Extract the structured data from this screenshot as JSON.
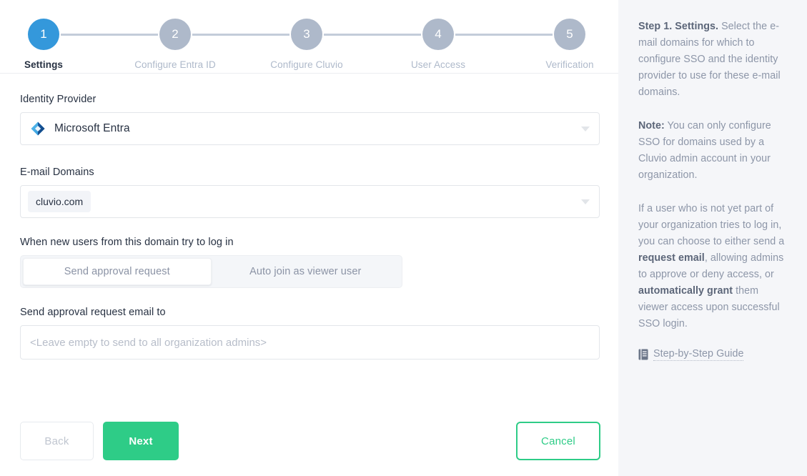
{
  "stepper": {
    "steps": [
      {
        "number": "1",
        "label": "Settings",
        "active": true
      },
      {
        "number": "2",
        "label": "Configure Entra ID",
        "active": false
      },
      {
        "number": "3",
        "label": "Configure Cluvio",
        "active": false
      },
      {
        "number": "4",
        "label": "User Access",
        "active": false
      },
      {
        "number": "5",
        "label": "Verification",
        "active": false
      }
    ],
    "active_color": "#3498db",
    "inactive_color": "#aeb9ca"
  },
  "form": {
    "identity_provider": {
      "label": "Identity Provider",
      "value": "Microsoft Entra",
      "icon": "microsoft-entra-logo"
    },
    "email_domains": {
      "label": "E-mail Domains",
      "tags": [
        "cluvio.com"
      ]
    },
    "new_user_policy": {
      "label": "When new users from this domain try to log in",
      "options": [
        {
          "label": "Send approval request",
          "selected": true
        },
        {
          "label": "Auto join as viewer user",
          "selected": false
        }
      ]
    },
    "approval_email": {
      "label": "Send approval request email to",
      "value": "",
      "placeholder": "<Leave empty to send to all organization admins>"
    }
  },
  "footer": {
    "back_label": "Back",
    "next_label": "Next",
    "cancel_label": "Cancel",
    "primary_color": "#2ecc87"
  },
  "help": {
    "paragraph1_bold": "Step 1. Settings.",
    "paragraph1_rest": " Select the e-mail domains for which to configure SSO and the identity provider to use for these e-mail domains.",
    "paragraph2_bold": "Note:",
    "paragraph2_rest": " You can only configure SSO for domains used by a Cluvio admin account in your organization.",
    "paragraph3_a": "If a user who is not yet part of your organization tries to log in, you can choose to either send a ",
    "paragraph3_b1": "request email",
    "paragraph3_c": ", allowing admins to approve or deny access, or ",
    "paragraph3_b2": "automatically grant",
    "paragraph3_d": " them viewer access upon successful SSO login.",
    "guide_link": "Step-by-Step Guide",
    "guide_icon": "book-icon"
  }
}
